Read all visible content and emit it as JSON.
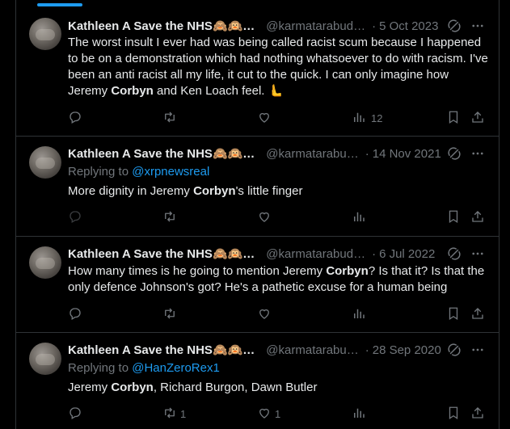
{
  "tweets": [
    {
      "name": "Kathleen A Save the NHS🙈🙉…",
      "handle": "@karmatarabud…",
      "sep": "·",
      "date": "5 Oct 2023",
      "reply_prefix": "",
      "reply_handle": "",
      "text_parts": [
        "The worst insult I ever had was being called racist scum because I happened to be on a demonstration which had nothing whatsoever to do with racism. I've been an anti racist all my life, it cut to the quick. I can only imagine how Jeremy ",
        "Corbyn",
        " and Ken Loach feel. 🫷"
      ],
      "replies": "",
      "retweets": "",
      "likes": "",
      "views": "12"
    },
    {
      "name": "Kathleen A Save the NHS🙈🙉…",
      "handle": "@karmatarabu…",
      "sep": "·",
      "date": "14 Nov 2021",
      "reply_prefix": "Replying to ",
      "reply_handle": "@xrpnewsreal",
      "text_parts": [
        "More dignity in Jeremy ",
        "Corbyn",
        "'s little finger"
      ],
      "replies": "",
      "retweets": "",
      "likes": "",
      "views": ""
    },
    {
      "name": "Kathleen A Save the NHS🙈🙉…",
      "handle": "@karmatarabud…",
      "sep": "·",
      "date": "6 Jul 2022",
      "reply_prefix": "",
      "reply_handle": "",
      "text_parts": [
        "How many times is he going to mention Jeremy ",
        "Corbyn",
        "? Is that it? Is that the only defence Johnson's got? He's a pathetic excuse for a human being"
      ],
      "replies": "",
      "retweets": "",
      "likes": "",
      "views": ""
    },
    {
      "name": "Kathleen A Save the NHS🙈🙉…",
      "handle": "@karmatarabu…",
      "sep": "·",
      "date": "28 Sep 2020",
      "reply_prefix": "Replying to ",
      "reply_handle": "@HanZeroRex1",
      "text_parts": [
        "Jeremy ",
        "Corbyn",
        ", Richard Burgon, Dawn Butler"
      ],
      "replies": "",
      "retweets": "1",
      "likes": "1",
      "views": ""
    }
  ],
  "colors": {
    "background": "#000000",
    "text": "#e7e9ea",
    "muted": "#71767b",
    "accent": "#1d9bf0",
    "border": "#2f3336"
  },
  "icons": [
    "grok-icon",
    "more-icon",
    "reply-icon",
    "retweet-icon",
    "like-icon",
    "views-icon",
    "bookmark-icon",
    "share-icon"
  ]
}
